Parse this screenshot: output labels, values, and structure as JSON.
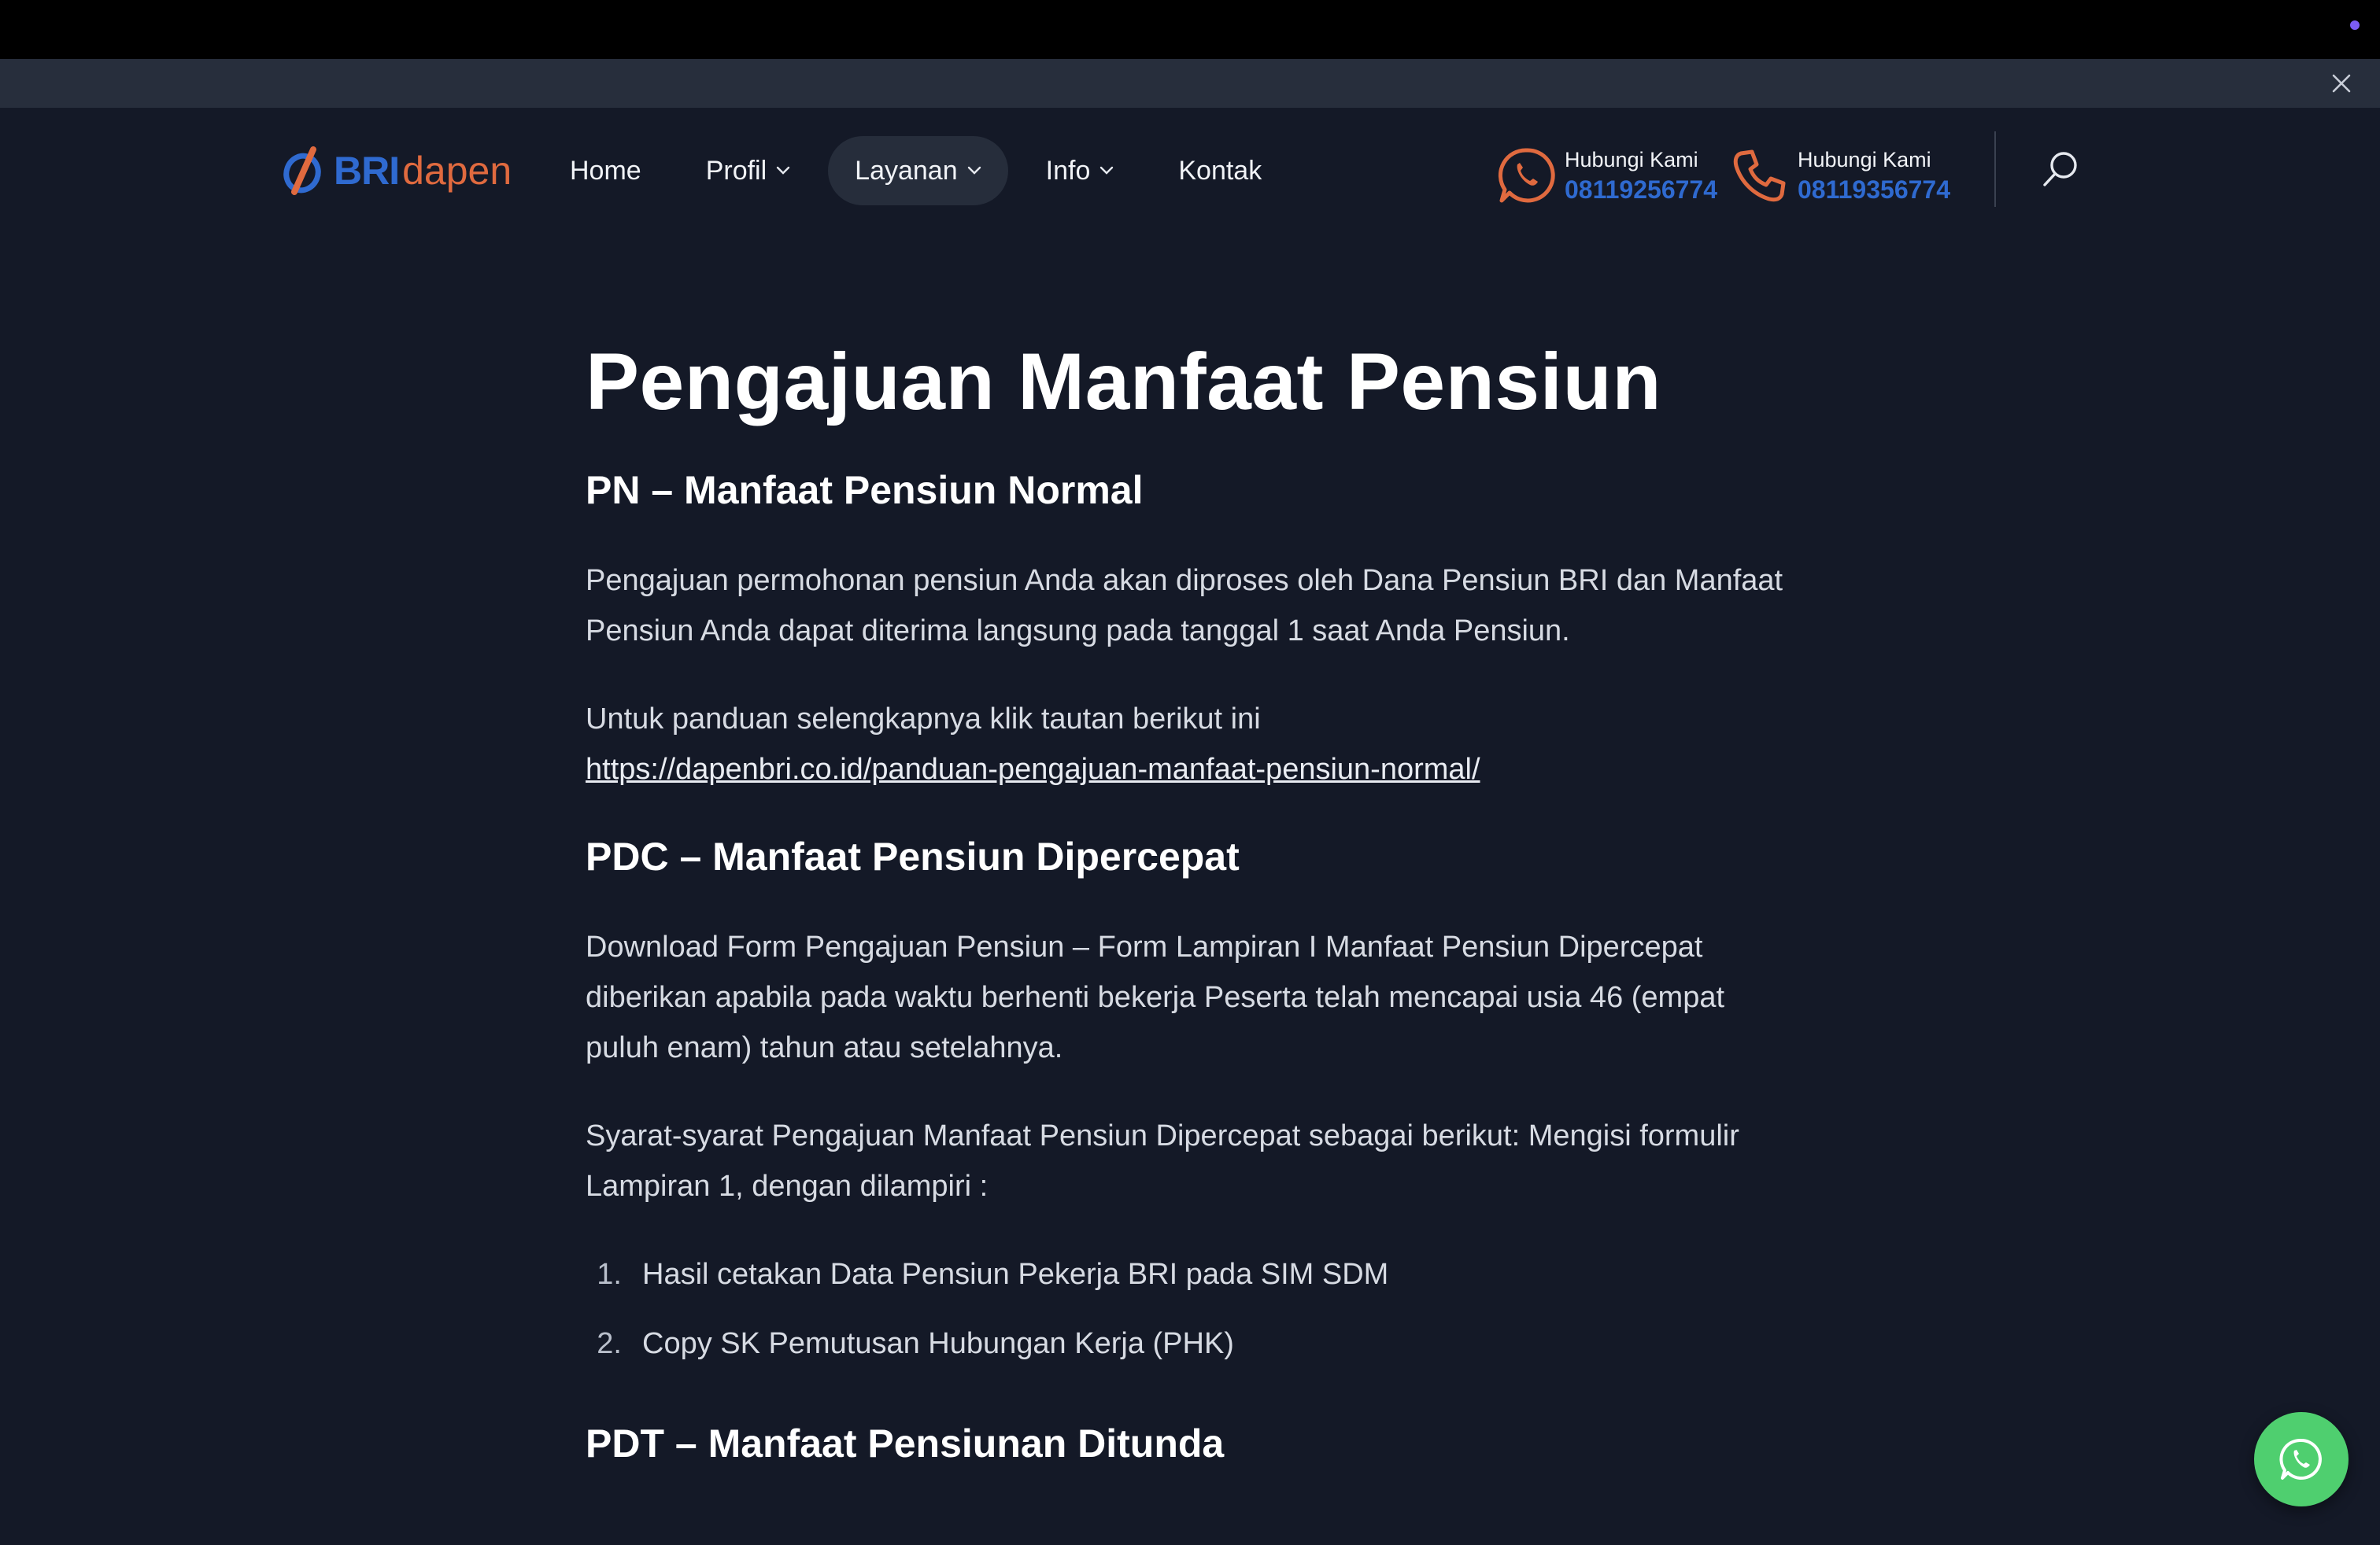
{
  "colors": {
    "background": "#141927",
    "accent_blue": "#2f6ad0",
    "accent_orange": "#e06a3f",
    "whatsapp_green": "#4fcf6f"
  },
  "logo": {
    "bri": "BRI",
    "dapen": "dapen"
  },
  "nav": {
    "items": [
      {
        "label": "Home",
        "has_dropdown": false
      },
      {
        "label": "Profil",
        "has_dropdown": true
      },
      {
        "label": "Layanan",
        "has_dropdown": true,
        "active": true
      },
      {
        "label": "Info",
        "has_dropdown": true
      },
      {
        "label": "Kontak",
        "has_dropdown": false
      }
    ]
  },
  "contacts": [
    {
      "icon": "whatsapp-icon",
      "label": "Hubungi Kami",
      "number": "08119256774"
    },
    {
      "icon": "phone-icon",
      "label": "Hubungi Kami",
      "number": "08119356774"
    }
  ],
  "content": {
    "title": "Pengajuan Manfaat Pensiun",
    "sections": {
      "pn": {
        "heading": "PN – Manfaat Pensiun Normal",
        "p1": "Pengajuan permohonan pensiun Anda akan diproses oleh Dana Pensiun BRI dan Manfaat Pensiun Anda dapat diterima langsung pada tanggal 1 saat Anda Pensiun.",
        "p2": "Untuk panduan selengkapnya klik tautan berikut ini",
        "link": "https://dapenbri.co.id/panduan-pengajuan-manfaat-pensiun-normal/"
      },
      "pdc": {
        "heading": "PDC – Manfaat Pensiun Dipercepat",
        "p1": "Download Form Pengajuan Pensiun – Form Lampiran I Manfaat Pensiun Dipercepat diberikan apabila pada waktu berhenti bekerja Peserta telah mencapai usia 46 (empat puluh enam) tahun atau setelahnya.",
        "p2": "Syarat-syarat Pengajuan Manfaat Pensiun Dipercepat sebagai berikut: Mengisi formulir Lampiran 1, dengan dilampiri :",
        "list": [
          {
            "n": "1.",
            "text": "Hasil cetakan Data Pensiun Pekerja BRI pada SIM SDM"
          },
          {
            "n": "2.",
            "text": "Copy SK Pemutusan Hubungan Kerja (PHK)"
          }
        ]
      },
      "pdt": {
        "heading": "PDT – Manfaat Pensiunan Ditunda"
      }
    }
  }
}
